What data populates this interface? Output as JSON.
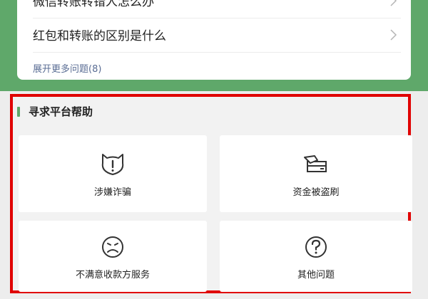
{
  "faq": {
    "items": [
      {
        "label": "微信转账转错人怎么办"
      },
      {
        "label": "红包和转账的区别是什么"
      }
    ],
    "expand_label": "展开更多问题(8)"
  },
  "help": {
    "title": "寻求平台帮助",
    "options": [
      {
        "label": "涉嫌诈骗",
        "icon": "fraud-alert-icon"
      },
      {
        "label": "资金被盗刷",
        "icon": "card-stolen-icon"
      },
      {
        "label": "不满意收款方服务",
        "icon": "unhappy-face-icon"
      },
      {
        "label": "其他问题",
        "icon": "question-icon"
      }
    ]
  },
  "colors": {
    "accent_green": "#5fa86a",
    "highlight_red": "#e00000",
    "link_blue": "#5a6d94"
  }
}
